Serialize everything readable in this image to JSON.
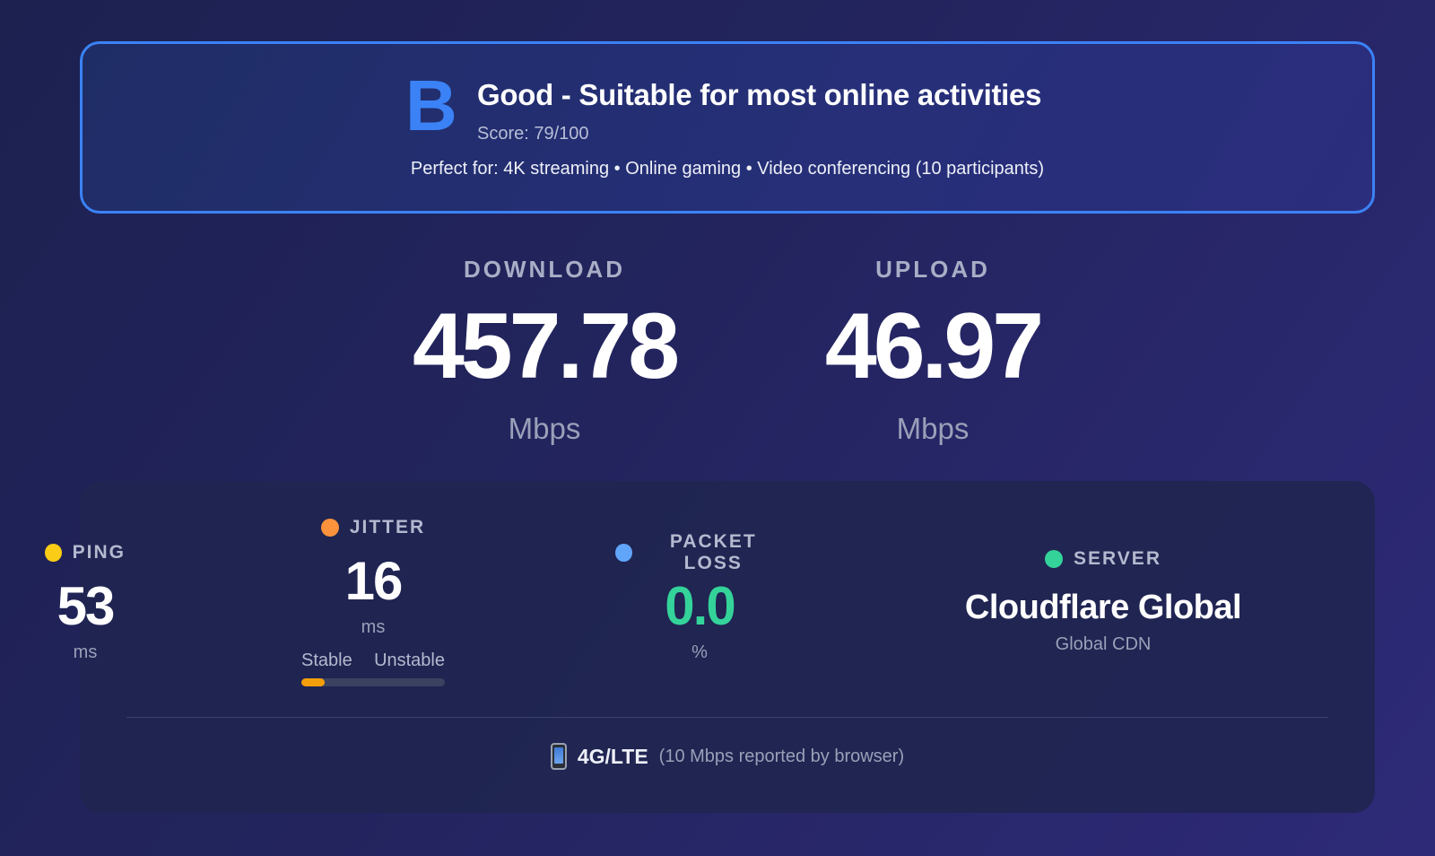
{
  "grade": {
    "letter": "B",
    "title": "Good - Suitable for most online activities",
    "score_text": "Score: 79/100",
    "perfect_for": "Perfect for: 4K streaming • Online gaming • Video conferencing (10 participants)"
  },
  "download": {
    "label": "DOWNLOAD",
    "value": "457.78",
    "unit": "Mbps"
  },
  "upload": {
    "label": "UPLOAD",
    "value": "46.97",
    "unit": "Mbps"
  },
  "metrics": {
    "ping": {
      "label": "PING",
      "value": "53",
      "unit": "ms",
      "dot_color": "#facc15"
    },
    "jitter": {
      "label": "JITTER",
      "value": "16",
      "unit": "ms",
      "dot_color": "#fb923c",
      "stable_label": "Stable",
      "unstable_label": "Unstable",
      "stability_fraction": 0.16,
      "bar_color": "#f59e0b"
    },
    "packet_loss": {
      "label": "PACKET LOSS",
      "value": "0.0",
      "unit": "%",
      "dot_color": "#60a5fa",
      "value_color": "#34d399"
    },
    "server": {
      "label": "SERVER",
      "value": "Cloudflare Global",
      "subtitle": "Global CDN",
      "dot_color": "#34d399"
    }
  },
  "connection": {
    "icon": "mobile-phone-icon",
    "type": "4G/LTE",
    "note": "(10 Mbps reported by browser)"
  },
  "colors": {
    "accent": "#3b82f6",
    "success": "#34d399",
    "warning": "#f59e0b"
  }
}
